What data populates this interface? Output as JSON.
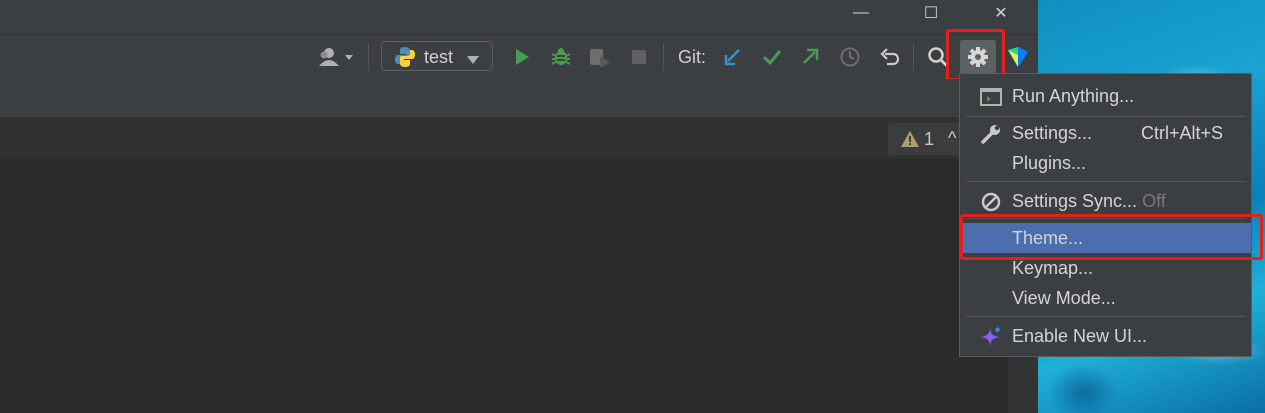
{
  "window": {
    "minimize_glyph": "—",
    "maximize_glyph": "☐",
    "close_glyph": "✕"
  },
  "toolbar": {
    "run_config": "test",
    "git_label": "Git:",
    "icons": [
      "user-icon",
      "python-icon",
      "run-icon",
      "debug-icon",
      "coverage-icon",
      "stop-icon",
      "git-update-icon",
      "git-commit-icon",
      "git-push-icon",
      "git-history-icon",
      "git-rollback-icon",
      "search-icon",
      "settings-gear-icon",
      "jetbrains-toolbox-icon"
    ]
  },
  "editor": {
    "warning_count": "1",
    "warning_chevron": "^"
  },
  "settings_menu": {
    "items": [
      {
        "label": "Run Anything...",
        "shortcut": "",
        "suffix": ""
      },
      {
        "label": "Settings...",
        "shortcut": "Ctrl+Alt+S",
        "suffix": ""
      },
      {
        "label": "Plugins...",
        "shortcut": "",
        "suffix": ""
      },
      {
        "label": "Settings Sync...",
        "shortcut": "",
        "suffix": "Off"
      },
      {
        "label": "Theme...",
        "shortcut": "",
        "suffix": ""
      },
      {
        "label": "Keymap...",
        "shortcut": "",
        "suffix": ""
      },
      {
        "label": "View Mode...",
        "shortcut": "",
        "suffix": ""
      },
      {
        "label": "Enable New UI...",
        "shortcut": "",
        "suffix": ""
      }
    ],
    "selected": "Theme..."
  },
  "colors": {
    "highlight_box": "#e5201c",
    "selected_item": "#4b6eaf",
    "run_green": "#499c54",
    "git_blue": "#3592c4"
  }
}
